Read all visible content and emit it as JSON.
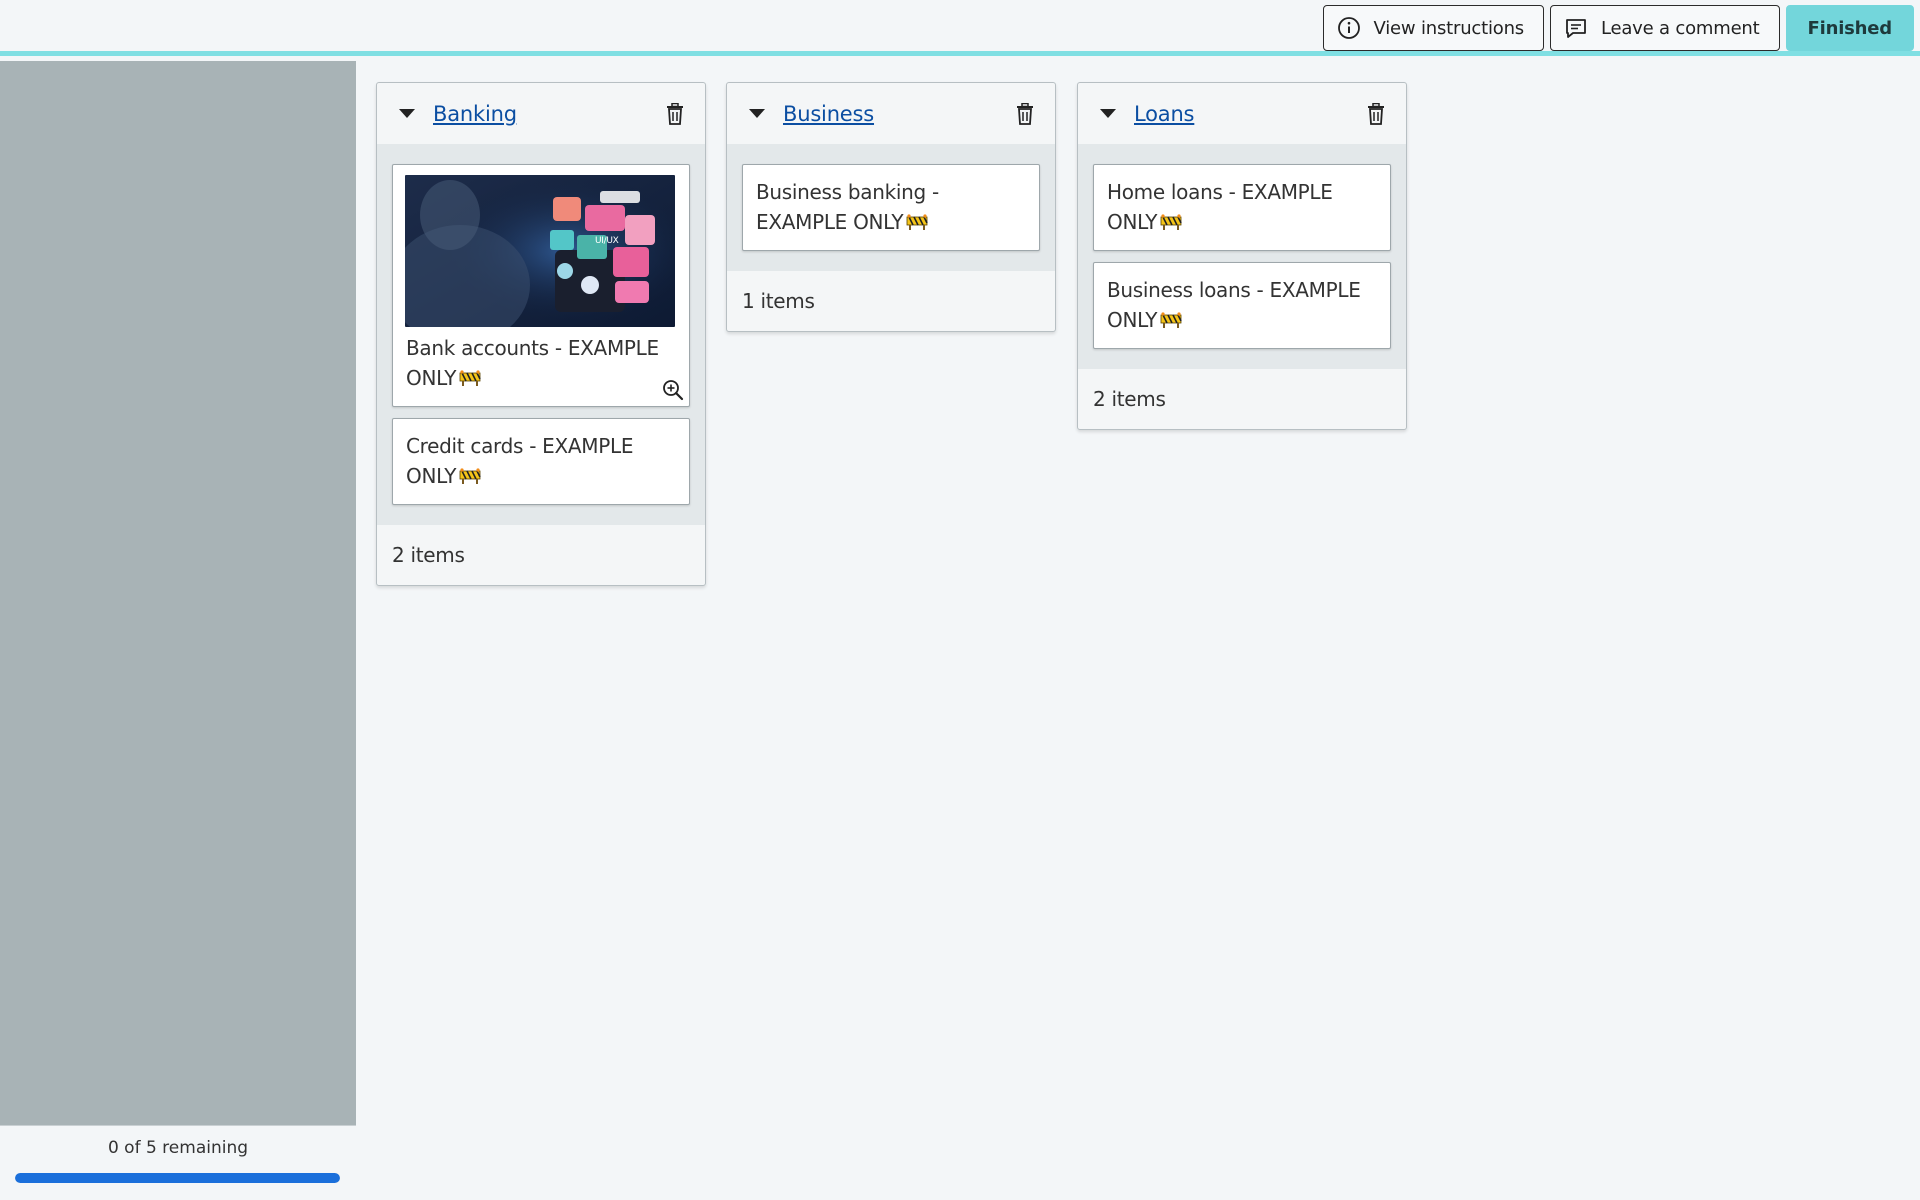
{
  "toolbar": {
    "instructions_label": "View instructions",
    "comment_label": "Leave a comment",
    "finished_label": "Finished"
  },
  "sidebar": {
    "remaining_text": "0 of 5 remaining",
    "progress_fraction": 1.0
  },
  "categories": [
    {
      "title": "Banking",
      "cards": [
        {
          "label": "Bank accounts - EXAMPLE ONLY",
          "has_image": true
        },
        {
          "label": "Credit cards - EXAMPLE ONLY",
          "has_image": false
        }
      ],
      "count_text": "2 items"
    },
    {
      "title": "Business",
      "cards": [
        {
          "label": "Business banking - EXAMPLE ONLY",
          "has_image": false
        }
      ],
      "count_text": "1 items"
    },
    {
      "title": "Loans",
      "cards": [
        {
          "label": "Home loans - EXAMPLE ONLY",
          "has_image": false
        },
        {
          "label": "Business loans - EXAMPLE ONLY",
          "has_image": false
        }
      ],
      "count_text": "2 items"
    }
  ],
  "icons": {
    "card_emoji": "construction-barrier-icon",
    "info": "info-icon",
    "comment": "comment-icon",
    "delete": "trash-icon",
    "zoom": "zoom-in-icon"
  },
  "colors": {
    "accent": "#73d6db",
    "link": "#0b4ea2",
    "progress": "#1a6fdb",
    "sidebar": "#a8b3b6"
  }
}
